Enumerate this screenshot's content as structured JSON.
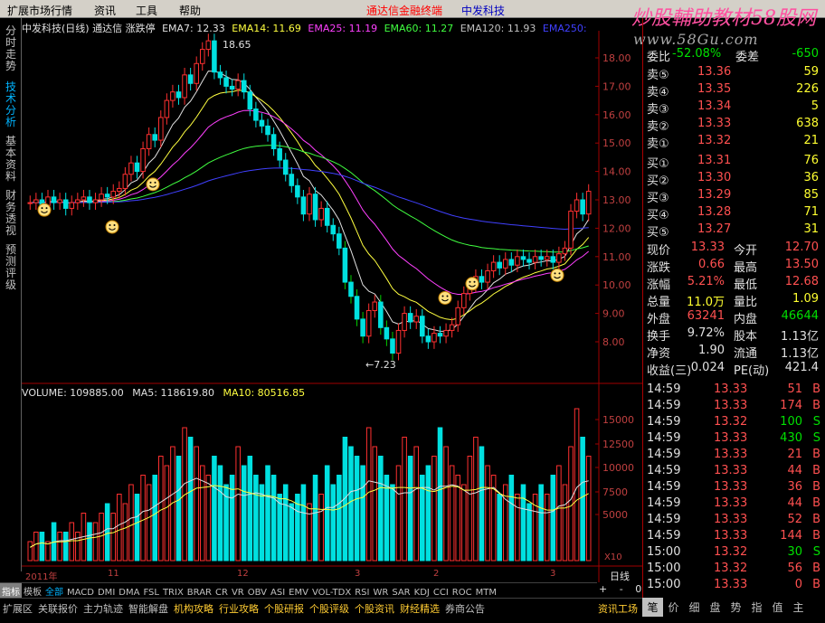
{
  "menu": {
    "items": [
      "扩展市场行情",
      "资讯",
      "工具",
      "帮助"
    ],
    "center_label": "通达信金融终端",
    "stock_name": "中发科技"
  },
  "watermark": {
    "title": "炒股輔助教材58股网",
    "url": "www.58Gu.com"
  },
  "left_tabs": [
    "分时走势",
    "技术分析",
    "基本资料",
    "财务透视",
    "预测评级"
  ],
  "chart_header": {
    "title": "中发科技(日线) 通达信 涨跌停",
    "ema7": "EMA7: 12.33",
    "ema14": "EMA14: 11.69",
    "ema25": "EMA25: 11.19",
    "ema60": "EMA60: 11.27",
    "ema120": "EMA120: 11.93",
    "ema250": "EMA250:"
  },
  "price_chart": {
    "high_label": "18.65",
    "low_label": "←7.23",
    "y_ticks": [
      "18.00",
      "17.00",
      "16.00",
      "15.00",
      "14.00",
      "13.00",
      "12.00",
      "11.00",
      "10.00",
      "9.00",
      "8.00"
    ]
  },
  "volume_header": {
    "volume": "VOLUME: 109885.00",
    "ma5": "MA5: 118619.80",
    "ma10": "MA10: 80516.85"
  },
  "volume_chart": {
    "y_ticks": [
      "15000",
      "12500",
      "10000",
      "7500",
      "5000"
    ],
    "unit": "X10"
  },
  "x_axis": {
    "labels": [
      "2011年",
      "11",
      "12",
      "3",
      "2",
      "3"
    ],
    "period": "日线"
  },
  "indicator_tabs": [
    "指标",
    "模板",
    "全部",
    "MACD",
    "DMI",
    "DMA",
    "FSL",
    "TRIX",
    "BRAR",
    "CR",
    "VR",
    "OBV",
    "ASI",
    "EMV",
    "VOL-TDX",
    "RSI",
    "WR",
    "SAR",
    "KDJ",
    "CCI",
    "ROC",
    "MTM"
  ],
  "nav_buttons": [
    "+",
    "-",
    "0"
  ],
  "bottom_tabs": [
    "扩展区",
    "关联报价",
    "主力轨迹",
    "智能解盘",
    "机构攻略",
    "行业攻略",
    "个股研报",
    "个股评级",
    "个股资讯",
    "财经精选",
    "券商公告",
    "资讯工场"
  ],
  "quote": {
    "ratio_top": {
      "l1": "委比",
      "v1": "-52.08%",
      "l2": "委差",
      "v2": "-650"
    },
    "sells": [
      {
        "label": "卖⑤",
        "price": "13.36",
        "vol": "59"
      },
      {
        "label": "卖④",
        "price": "13.35",
        "vol": "226"
      },
      {
        "label": "卖③",
        "price": "13.34",
        "vol": "5"
      },
      {
        "label": "卖②",
        "price": "13.33",
        "vol": "638"
      },
      {
        "label": "卖①",
        "price": "13.32",
        "vol": "21"
      }
    ],
    "buys": [
      {
        "label": "买①",
        "price": "13.31",
        "vol": "76"
      },
      {
        "label": "买②",
        "price": "13.30",
        "vol": "36"
      },
      {
        "label": "买③",
        "price": "13.29",
        "vol": "85"
      },
      {
        "label": "买④",
        "price": "13.28",
        "vol": "71"
      },
      {
        "label": "买⑤",
        "price": "13.27",
        "vol": "31"
      }
    ],
    "stats": [
      {
        "l1": "现价",
        "v1": "13.33",
        "l2": "今开",
        "v2": "12.70"
      },
      {
        "l1": "涨跌",
        "v1": "0.66",
        "l2": "最高",
        "v2": "13.50"
      },
      {
        "l1": "涨幅",
        "v1": "5.21%",
        "l2": "最低",
        "v2": "12.68"
      },
      {
        "l1": "总量",
        "v1": "11.0万",
        "l2": "量比",
        "v2": "1.09"
      },
      {
        "l1": "外盘",
        "v1": "63241",
        "l2": "内盘",
        "v2": "46644"
      },
      {
        "l1": "换手",
        "v1": "9.72%",
        "l2": "股本",
        "v2": "1.13亿"
      },
      {
        "l1": "净资",
        "v1": "1.90",
        "l2": "流通",
        "v2": "1.13亿"
      },
      {
        "l1": "收益(三)",
        "v1": "0.024",
        "l2": "PE(动)",
        "v2": "421.4"
      }
    ],
    "ticks": [
      {
        "time": "14:59",
        "price": "13.33",
        "vol": "51",
        "side": "B"
      },
      {
        "time": "14:59",
        "price": "13.33",
        "vol": "174",
        "side": "B"
      },
      {
        "time": "14:59",
        "price": "13.32",
        "vol": "100",
        "side": "S"
      },
      {
        "time": "14:59",
        "price": "13.33",
        "vol": "430",
        "side": "S"
      },
      {
        "time": "14:59",
        "price": "13.33",
        "vol": "21",
        "side": "B"
      },
      {
        "time": "14:59",
        "price": "13.33",
        "vol": "44",
        "side": "B"
      },
      {
        "time": "14:59",
        "price": "13.33",
        "vol": "36",
        "side": "B"
      },
      {
        "time": "14:59",
        "price": "13.33",
        "vol": "44",
        "side": "B"
      },
      {
        "time": "14:59",
        "price": "13.33",
        "vol": "52",
        "side": "B"
      },
      {
        "time": "14:59",
        "price": "13.33",
        "vol": "144",
        "side": "B"
      },
      {
        "time": "15:00",
        "price": "13.32",
        "vol": "30",
        "side": "S"
      },
      {
        "time": "15:00",
        "price": "13.32",
        "vol": "56",
        "side": "B"
      },
      {
        "time": "15:00",
        "price": "13.33",
        "vol": "0",
        "side": "B"
      }
    ]
  },
  "right_tabs": [
    "笔",
    "价",
    "细",
    "盘",
    "势",
    "指",
    "值",
    "主"
  ]
}
